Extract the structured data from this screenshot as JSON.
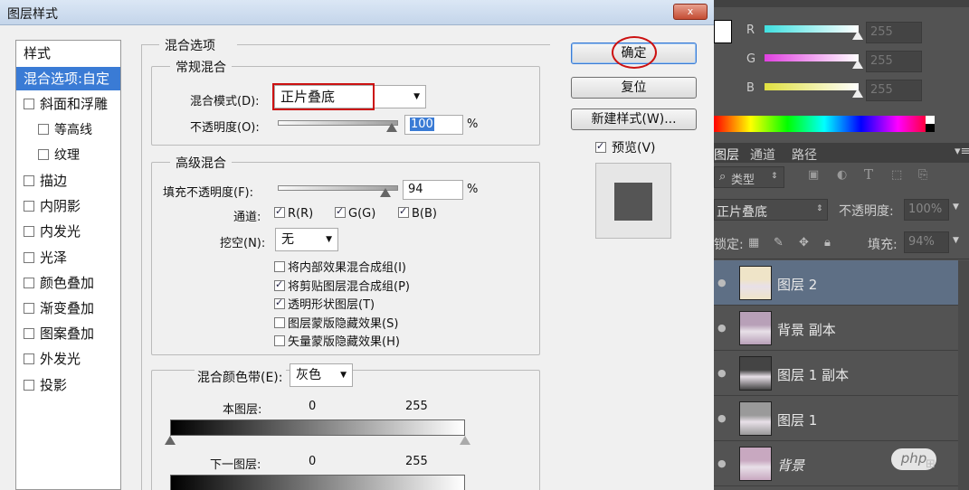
{
  "dialog": {
    "title": "图层样式",
    "close_label": "x",
    "styles_list": [
      {
        "label": "样式",
        "checkbox": false,
        "checked": false,
        "selected": false
      },
      {
        "label": "混合选项:自定",
        "checkbox": false,
        "checked": false,
        "selected": true
      },
      {
        "label": "斜面和浮雕",
        "checkbox": true,
        "checked": false,
        "selected": false
      },
      {
        "label": "等高线",
        "checkbox": true,
        "checked": false,
        "selected": false
      },
      {
        "label": "纹理",
        "checkbox": true,
        "checked": false,
        "selected": false
      },
      {
        "label": "描边",
        "checkbox": true,
        "checked": false,
        "selected": false
      },
      {
        "label": "内阴影",
        "checkbox": true,
        "checked": false,
        "selected": false
      },
      {
        "label": "内发光",
        "checkbox": true,
        "checked": false,
        "selected": false
      },
      {
        "label": "光泽",
        "checkbox": true,
        "checked": false,
        "selected": false
      },
      {
        "label": "颜色叠加",
        "checkbox": true,
        "checked": false,
        "selected": false
      },
      {
        "label": "渐变叠加",
        "checkbox": true,
        "checked": false,
        "selected": false
      },
      {
        "label": "图案叠加",
        "checkbox": true,
        "checked": false,
        "selected": false
      },
      {
        "label": "外发光",
        "checkbox": true,
        "checked": false,
        "selected": false
      },
      {
        "label": "投影",
        "checkbox": true,
        "checked": false,
        "selected": false
      }
    ],
    "blend_options": {
      "section_title": "混合选项",
      "general": {
        "title": "常规混合",
        "blend_mode_label": "混合模式(D):",
        "blend_mode_value": "正片叠底",
        "opacity_label": "不透明度(O):",
        "opacity_value": "100",
        "opacity_unit": "%"
      },
      "advanced": {
        "title": "高级混合",
        "fill_opacity_label": "填充不透明度(F):",
        "fill_opacity_value": "94",
        "fill_unit": "%",
        "channels_label": "通道:",
        "channels": [
          {
            "label": "R(R)",
            "checked": true
          },
          {
            "label": "G(G)",
            "checked": true
          },
          {
            "label": "B(B)",
            "checked": true
          }
        ],
        "knockout_label": "挖空(N):",
        "knockout_value": "无",
        "options": [
          {
            "label": "将内部效果混合成组(I)",
            "checked": false
          },
          {
            "label": "将剪贴图层混合成组(P)",
            "checked": true
          },
          {
            "label": "透明形状图层(T)",
            "checked": true
          },
          {
            "label": "图层蒙版隐藏效果(S)",
            "checked": false
          },
          {
            "label": "矢量蒙版隐藏效果(H)",
            "checked": false
          }
        ]
      },
      "blend_if": {
        "label": "混合颜色带(E):",
        "value": "灰色",
        "this_layer_label": "本图层:",
        "this_min": "0",
        "this_max": "255",
        "underlying_label": "下一图层:",
        "under_min": "0",
        "under_max": "255"
      }
    },
    "buttons": {
      "ok": "确定",
      "reset": "复位",
      "new_style": "新建样式(W)...",
      "preview_label": "预览(V)"
    }
  },
  "photoshop": {
    "color_panel": {
      "channels": [
        {
          "label": "R",
          "value": "255",
          "color": "#40e0e0"
        },
        {
          "label": "G",
          "value": "255",
          "color": "#e040e0"
        },
        {
          "label": "B",
          "value": "255",
          "color": "#e0e040"
        }
      ]
    },
    "layers_panel": {
      "tabs": [
        "图层",
        "通道",
        "路径"
      ],
      "filter_label": "类型",
      "filter_icons": [
        "image-filter-icon",
        "adjustment-filter-icon",
        "text-filter-icon",
        "shape-filter-icon",
        "smart-object-filter-icon"
      ],
      "blend_mode": "正片叠底",
      "opacity_label": "不透明度:",
      "opacity_value": "100%",
      "lock_label": "锁定:",
      "fill_label": "填充:",
      "fill_value": "94%",
      "layers": [
        {
          "name": "图层 2",
          "selected": true,
          "italic": false,
          "thumb": "#efe4c8"
        },
        {
          "name": "背景 副本",
          "selected": false,
          "italic": false,
          "thumb": "#b8a0b8"
        },
        {
          "name": "图层 1 副本",
          "selected": false,
          "italic": false,
          "thumb": "#444444"
        },
        {
          "name": "图层 1",
          "selected": false,
          "italic": false,
          "thumb": "#9a9a9a"
        },
        {
          "name": "背景",
          "selected": false,
          "italic": true,
          "thumb": "#c8a8c0"
        }
      ]
    },
    "watermark": "php"
  },
  "colors": {
    "selection_blue": "#3a7bd5",
    "highlight_red": "#cc1111",
    "ps_panel": "#535353"
  }
}
